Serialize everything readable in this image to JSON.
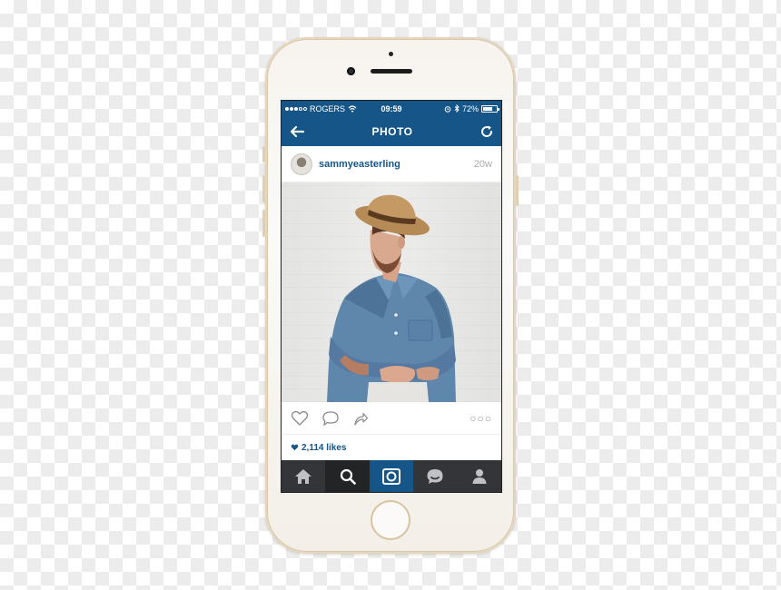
{
  "status_bar": {
    "carrier": "ROGERS",
    "time": "09:59",
    "battery": "72%",
    "battery_level": 0.72
  },
  "nav": {
    "title": "PHOTO",
    "back_icon": "arrow-left-icon",
    "refresh_icon": "refresh-icon"
  },
  "post": {
    "username": "sammyeasterling",
    "age": "20w",
    "likes": "2,114 likes"
  },
  "tabs": [
    {
      "icon": "home-icon"
    },
    {
      "icon": "search-icon"
    },
    {
      "icon": "camera-icon"
    },
    {
      "icon": "activity-bubble-icon"
    },
    {
      "icon": "profile-icon"
    }
  ],
  "colors": {
    "brand": "#155588",
    "tab_bar": "#333538",
    "phone_gold": "#e4d6bf"
  }
}
